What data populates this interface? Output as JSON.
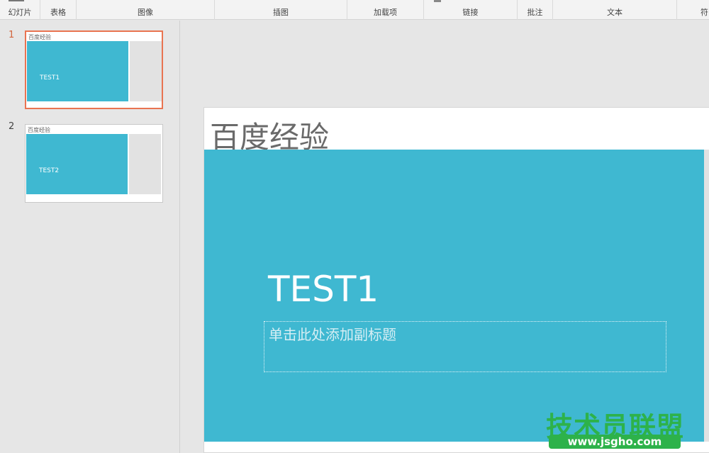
{
  "ribbon": {
    "groups": [
      {
        "label": "幻灯片"
      },
      {
        "label": "表格"
      },
      {
        "label": "图像"
      },
      {
        "label": "插图"
      },
      {
        "label": "加载项"
      },
      {
        "label": "链接"
      },
      {
        "label": "批注"
      },
      {
        "label": "文本"
      },
      {
        "label": "符"
      }
    ]
  },
  "thumbnails": [
    {
      "number": "1",
      "title": "百度经验",
      "text": "TEST1",
      "selected": true
    },
    {
      "number": "2",
      "title": "百度经验",
      "text": "TEST2",
      "selected": false
    }
  ],
  "slide": {
    "title": "百度经验",
    "heading": "TEST1",
    "subtitle_placeholder": "单击此处添加副标题",
    "band_color": "#3fb8d1"
  },
  "watermark": {
    "text": "技术员联盟",
    "url": "www.jsgho.com"
  }
}
